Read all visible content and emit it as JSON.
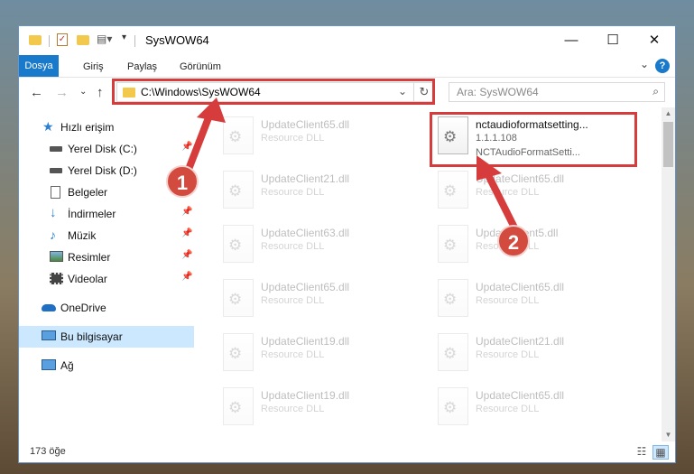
{
  "window": {
    "title": "SysWOW64"
  },
  "ribbon": {
    "tabs": [
      "Dosya",
      "Giriş",
      "Paylaş",
      "Görünüm"
    ]
  },
  "navigation": {
    "address": "C:\\Windows\\SysWOW64",
    "search_placeholder": "Ara: SysWOW64"
  },
  "sidebar": {
    "items": [
      {
        "label": "Hızlı erişim",
        "icon": "star-icon",
        "pinned": false
      },
      {
        "label": "Yerel Disk (C:)",
        "icon": "drive-icon",
        "pinned": true
      },
      {
        "label": "Yerel Disk (D:)",
        "icon": "drive-icon",
        "pinned": true
      },
      {
        "label": "Belgeler",
        "icon": "documents-icon",
        "pinned": true
      },
      {
        "label": "İndirmeler",
        "icon": "download-icon",
        "pinned": true
      },
      {
        "label": "Müzik",
        "icon": "music-icon",
        "pinned": true
      },
      {
        "label": "Resimler",
        "icon": "pictures-icon",
        "pinned": true
      },
      {
        "label": "Videolar",
        "icon": "video-icon",
        "pinned": true
      },
      {
        "label": "OneDrive",
        "icon": "cloud-icon",
        "pinned": false
      },
      {
        "label": "Bu bilgisayar",
        "icon": "computer-icon",
        "pinned": false,
        "selected": true
      },
      {
        "label": "Ağ",
        "icon": "network-icon",
        "pinned": false
      }
    ]
  },
  "files": [
    {
      "name": "UpdateClient65.dll",
      "desc": "Resource DLL",
      "dimmed": true
    },
    {
      "name": "nctaudioformatsetting...",
      "desc": "1.1.1.108",
      "desc2": "NCTAudioFormatSetti...",
      "dimmed": false
    },
    {
      "name": "UpdateClient21.dll",
      "desc": "Resource DLL",
      "dimmed": true
    },
    {
      "name": "UpdateClient65.dll",
      "desc": "Resource DLL",
      "dimmed": true
    },
    {
      "name": "UpdateClient63.dll",
      "desc": "Resource DLL",
      "dimmed": true
    },
    {
      "name": "UpdateClient5.dll",
      "desc": "Resource DLL",
      "dimmed": true
    },
    {
      "name": "UpdateClient65.dll",
      "desc": "Resource DLL",
      "dimmed": true
    },
    {
      "name": "UpdateClient65.dll",
      "desc": "Resource DLL",
      "dimmed": true
    },
    {
      "name": "UpdateClient19.dll",
      "desc": "Resource DLL",
      "dimmed": true
    },
    {
      "name": "UpdateClient21.dll",
      "desc": "Resource DLL",
      "dimmed": true
    },
    {
      "name": "UpdateClient19.dll",
      "desc": "Resource DLL",
      "dimmed": true
    },
    {
      "name": "UpdateClient65.dll",
      "desc": "Resource DLL",
      "dimmed": true
    }
  ],
  "status": {
    "item_count": "173 öğe"
  },
  "annotations": {
    "badge1": "1",
    "badge2": "2",
    "color": "#d63c3c"
  }
}
